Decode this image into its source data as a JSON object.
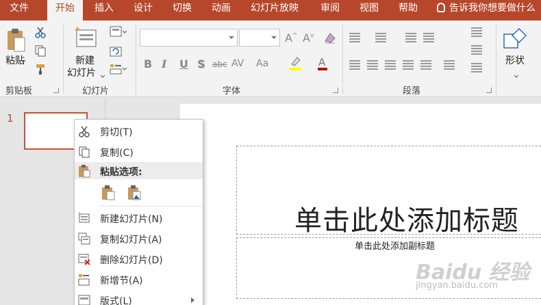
{
  "tabs": [
    {
      "label": "文件"
    },
    {
      "label": "开始"
    },
    {
      "label": "插入"
    },
    {
      "label": "设计"
    },
    {
      "label": "切换"
    },
    {
      "label": "动画"
    },
    {
      "label": "幻灯片放映"
    },
    {
      "label": "审阅"
    },
    {
      "label": "视图"
    },
    {
      "label": "帮助"
    }
  ],
  "active_tab": "开始",
  "tell_me": "告诉我你想要做什么",
  "ribbon": {
    "paste_label": "粘贴",
    "new_slide_label_line1": "新建",
    "new_slide_label_line2": "幻灯片",
    "shape_label": "形状",
    "groups": {
      "clipboard": "剪贴板",
      "slides": "幻灯片",
      "font": "字体",
      "paragraph": "段落"
    },
    "font_buttons": [
      "B",
      "I",
      "U",
      "S",
      "abc",
      "AV",
      "Aa"
    ]
  },
  "slides_pane": {
    "slide_number": "1"
  },
  "slide": {
    "title_placeholder": "单击此处添加标题",
    "subtitle_placeholder": "单击此处添加副标题"
  },
  "watermark": {
    "brand": "Baidu 经验",
    "url": "jingyan.baidu.com"
  },
  "context_menu": {
    "cut": "剪切(T)",
    "copy": "复制(C)",
    "paste_options": "粘贴选项:",
    "new_slide": "新建幻灯片(N)",
    "duplicate_slide": "复制幻灯片(A)",
    "delete_slide": "删除幻灯片(D)",
    "add_section": "新增节(A)",
    "layout": "版式(L)"
  },
  "colors": {
    "accent": "#b7472a",
    "ribbon_bg": "#f3f3f3",
    "pane_bg": "#e6e6e6"
  }
}
